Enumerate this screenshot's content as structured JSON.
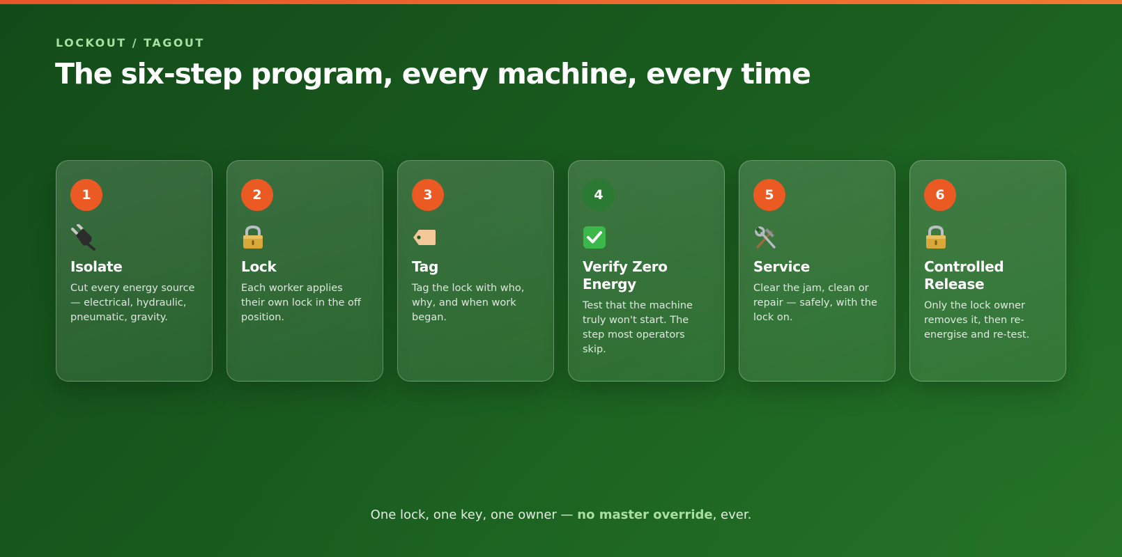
{
  "header": {
    "eyebrow": "LOCKOUT / TAGOUT",
    "title": "The six-step program, every machine, every time"
  },
  "steps": [
    {
      "number": "1",
      "icon": "plug-icon",
      "title": "Isolate",
      "description": "Cut every energy source — electrical, hydraulic, pneumatic, gravity."
    },
    {
      "number": "2",
      "icon": "padlock-icon",
      "title": "Lock",
      "description": "Each worker applies their own lock in the off position."
    },
    {
      "number": "3",
      "icon": "tag-icon",
      "title": "Tag",
      "description": "Tag the lock with who, why, and when work began."
    },
    {
      "number": "4",
      "icon": "check-mark-icon",
      "title": "Verify Zero Energy",
      "description": "Test that the machine truly won't start. The step most operators skip."
    },
    {
      "number": "5",
      "icon": "hammer-wrench-icon",
      "title": "Service",
      "description": "Clear the jam, clean or repair — safely, with the lock on."
    },
    {
      "number": "6",
      "icon": "padlock-icon",
      "title": "Controlled Release",
      "description": "Only the lock owner removes it, then re-energise and re-test."
    }
  ],
  "footer": {
    "before": "One lock, one key, one owner — ",
    "highlight": "no master override",
    "after": ", ever."
  },
  "colors": {
    "accent": "#ec5a24",
    "verify_badge": "#2a7a33",
    "highlight_text": "#a9dfa1"
  }
}
